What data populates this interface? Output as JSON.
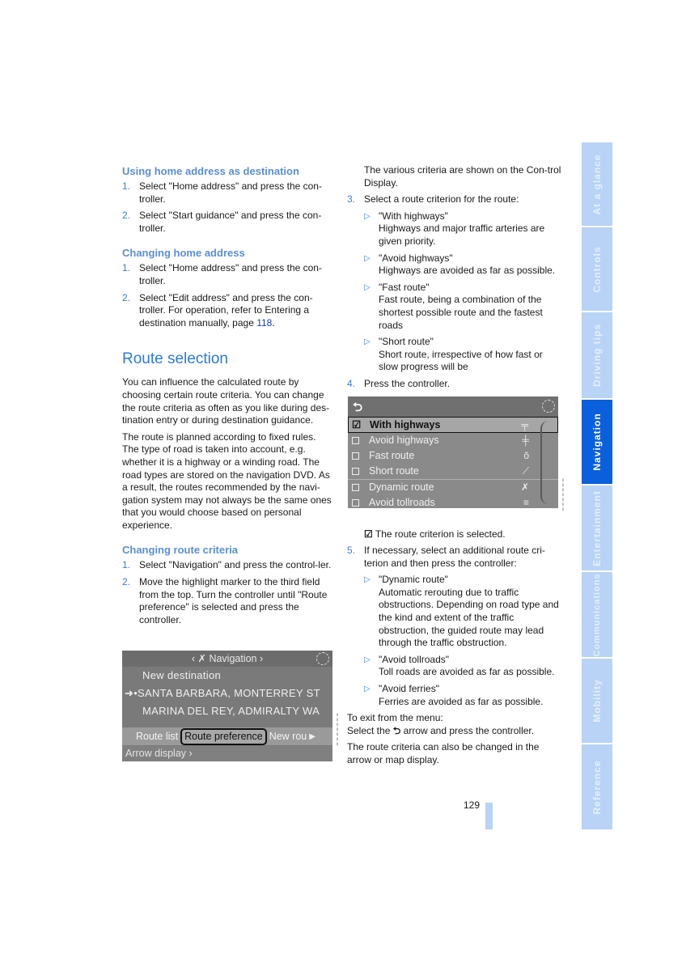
{
  "left_column": {
    "section1": {
      "heading": "Using home address as destination",
      "steps": [
        {
          "num": "1.",
          "text": "Select \"Home address\" and press the con-troller."
        },
        {
          "num": "2.",
          "text": "Select \"Start guidance\" and press the con-troller."
        }
      ]
    },
    "section2": {
      "heading": "Changing home address",
      "step1": {
        "num": "1.",
        "text": "Select \"Home address\" and press the con-troller."
      },
      "step2": {
        "num": "2.",
        "text_before": "Select \"Edit address\" and press the con-troller. For operation, refer to Entering a destination manually, page ",
        "link": "118",
        "text_after": "."
      }
    },
    "route_selection": {
      "heading": "Route selection",
      "paragraphs": [
        "You can influence the calculated route by choosing certain route criteria. You can change the route criteria as often as you like during des-tination entry or during destination guidance.",
        "The route is planned according to fixed rules. The type of road is taken into account, e.g. whether it is a highway or a winding road. The road types are stored on the navigation DVD. As a result, the routes recommended by the navi-gation system may not always be the same ones that you would choose based on personal experience."
      ]
    },
    "section3": {
      "heading": "Changing route criteria",
      "steps": [
        {
          "num": "1.",
          "text": "Select \"Navigation\" and press the control-ler."
        },
        {
          "num": "2.",
          "text": "Move the highlight marker to the third field from the top. Turn the controller until \"Route preference\" is selected and press the controller."
        }
      ]
    }
  },
  "nav_screen": {
    "title": "Navigation",
    "title_left_arrow": "‹",
    "title_right_arrow": "›",
    "lines": [
      "New destination",
      "SANTA BARBARA, MONTERREY ST",
      "MARINA DEL REY, ADMIRALTY WA"
    ],
    "selected_marker": "➜•",
    "tabs": [
      "Route list",
      "Route preference",
      "New rou"
    ],
    "active_tab": "Route preference",
    "bottom": "Arrow display ›"
  },
  "right_column": {
    "intro": "The various criteria are shown on the Con-trol Display.",
    "step3": {
      "num": "3.",
      "text": "Select a route criterion for the route:"
    },
    "criteria": [
      {
        "name": "\"With highways\"",
        "desc": "Highways and major traffic arteries are given priority."
      },
      {
        "name": "\"Avoid highways\"",
        "desc": "Highways are avoided as far as possible."
      },
      {
        "name": "\"Fast route\"",
        "desc": "Fast route, being a combination of the shortest possible route and the fastest roads"
      },
      {
        "name": "\"Short route\"",
        "desc": "Short route, irrespective of how fast or slow progress will be"
      }
    ],
    "step4": {
      "num": "4.",
      "text": "Press the controller."
    },
    "selected_note": "The route criterion is selected.",
    "step5": {
      "num": "5.",
      "text": "If necessary, select an additional route cri-terion and then press the controller:"
    },
    "extra_criteria": [
      {
        "name": "\"Dynamic route\"",
        "desc": "Automatic rerouting due to traffic obstructions. Depending on road type and the kind and extent of the traffic obstruction, the guided route may lead through the traffic obstruction."
      },
      {
        "name": "\"Avoid tollroads\"",
        "desc": "Toll roads are avoided as far as possible."
      },
      {
        "name": "\"Avoid ferries\"",
        "desc": "Ferries are avoided as far as possible."
      }
    ],
    "exit_label": "To exit from the menu:",
    "exit_before": "Select the ",
    "exit_after": " arrow and press the controller.",
    "closing": "The route criteria can also be changed in the arrow or map display."
  },
  "route_screen": {
    "back_icon": "⮌",
    "rows": [
      {
        "label": "With highways",
        "checked": true,
        "icon": "╤"
      },
      {
        "label": "Avoid highways",
        "checked": false,
        "icon": "╪"
      },
      {
        "label": "Fast route",
        "checked": false,
        "icon": "ŏ"
      },
      {
        "label": "Short route",
        "checked": false,
        "icon": "⟋"
      },
      {
        "label": "Dynamic route",
        "checked": false,
        "icon": "✗"
      },
      {
        "label": "Avoid tollroads",
        "checked": false,
        "icon": "≡"
      }
    ],
    "check_glyph": "☑"
  },
  "sidebar": {
    "tabs": [
      "At a glance",
      "Controls",
      "Driving tips",
      "Navigation",
      "Entertainment",
      "Communications",
      "Mobility",
      "Reference"
    ],
    "active": "Navigation",
    "colors": {
      "inactive": "#b8d3f5",
      "active": "#0a5fdc"
    }
  },
  "page_number": "129"
}
